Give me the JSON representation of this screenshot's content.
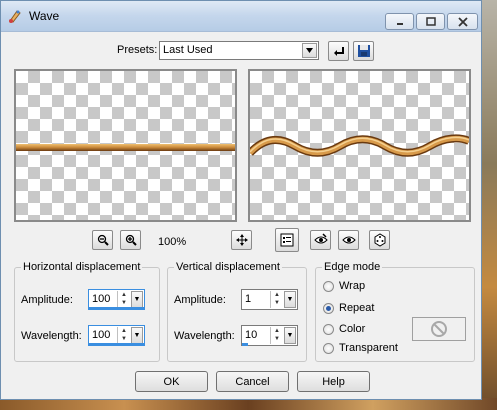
{
  "window": {
    "title": "Wave"
  },
  "presets": {
    "label": "Presets:",
    "selected": "Last Used"
  },
  "zoom": {
    "level": "100%"
  },
  "horizontal": {
    "title": "Horizontal displacement",
    "amplitude_label": "Amplitude:",
    "amplitude": "100",
    "wavelength_label": "Wavelength:",
    "wavelength": "100"
  },
  "vertical": {
    "title": "Vertical displacement",
    "amplitude_label": "Amplitude:",
    "amplitude": "1",
    "wavelength_label": "Wavelength:",
    "wavelength": "10"
  },
  "edge": {
    "title": "Edge mode",
    "options": [
      "Wrap",
      "Repeat",
      "Color",
      "Transparent"
    ],
    "selected": "Repeat"
  },
  "buttons": {
    "ok": "OK",
    "cancel": "Cancel",
    "help": "Help"
  },
  "colors": {
    "titlebar": "#c4d6ec",
    "accent": "#3a8ee0",
    "rope": "#c8883a"
  }
}
